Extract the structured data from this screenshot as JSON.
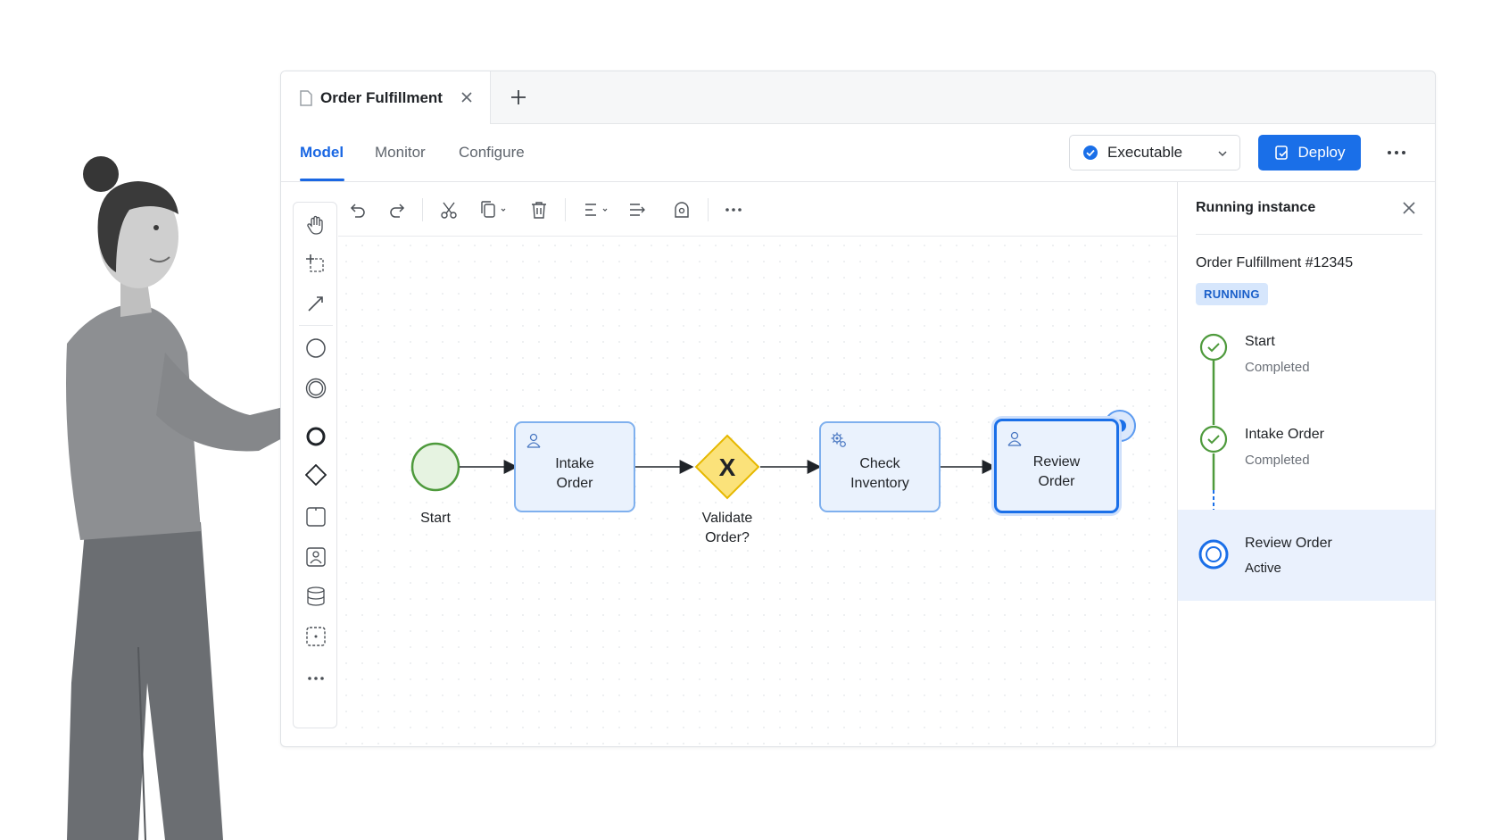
{
  "app": {
    "doc_tab": {
      "label": "Order Fulfillment"
    },
    "nav_tabs": [
      {
        "label": "Model",
        "active": true
      },
      {
        "label": "Monitor",
        "active": false
      },
      {
        "label": "Configure",
        "active": false
      }
    ],
    "execution_select": {
      "value": "Executable"
    },
    "deploy_label": "Deploy"
  },
  "diagram": {
    "start_event": {
      "label": "Start"
    },
    "tasks": [
      {
        "label_line1": "Intake",
        "label_line2": "Order",
        "icon": "user-icon"
      },
      {
        "label_line1": "Check",
        "label_line2": "Inventory",
        "icon": "gears-icon"
      },
      {
        "label_line1": "Review",
        "label_line2": "Order",
        "icon": "user-icon",
        "active": true
      }
    ],
    "gateway": {
      "symbol": "X",
      "label_line1": "Validate",
      "label_line2": "Order?"
    }
  },
  "panel": {
    "title": "Running instance",
    "instance_name": "Order Fulfillment #12345",
    "status_badge": "RUNNING",
    "steps": [
      {
        "name": "Start",
        "status": "Completed"
      },
      {
        "name": "Intake Order",
        "status": "Completed"
      },
      {
        "name": "Review Order",
        "status": "Active"
      }
    ]
  },
  "colors": {
    "primary": "#1a6fe8",
    "start_green": "#4e9a3c",
    "gateway_yellow": "#f6d22e",
    "task_fill": "#eaf2fd"
  }
}
